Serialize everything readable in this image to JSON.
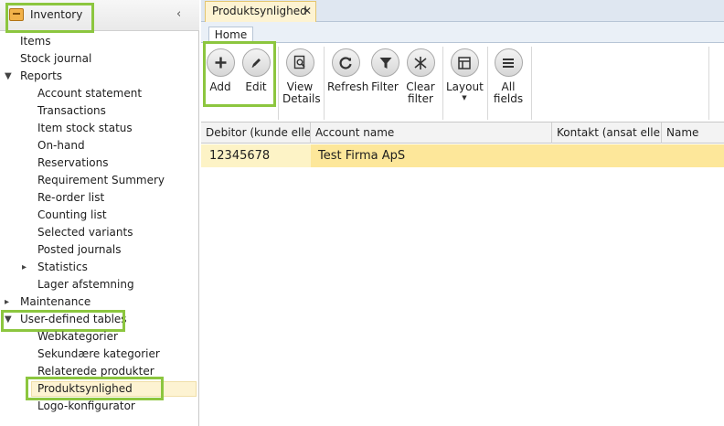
{
  "sidebar": {
    "module_title": "Inventory",
    "collapse_glyph": "‹",
    "items": [
      {
        "label": "Items"
      },
      {
        "label": "Stock journal"
      },
      {
        "label": "Reports"
      },
      {
        "label": "Account statement"
      },
      {
        "label": "Transactions"
      },
      {
        "label": "Item stock status"
      },
      {
        "label": "On-hand"
      },
      {
        "label": "Reservations"
      },
      {
        "label": "Requirement Summery"
      },
      {
        "label": "Re-order list"
      },
      {
        "label": "Counting list"
      },
      {
        "label": "Selected variants"
      },
      {
        "label": "Posted journals"
      },
      {
        "label": "Statistics"
      },
      {
        "label": "Lager afstemning"
      },
      {
        "label": "Maintenance"
      },
      {
        "label": "User-defined tables"
      },
      {
        "label": "Webkategorier"
      },
      {
        "label": "Sekundære kategorier"
      },
      {
        "label": "Relaterede produkter"
      },
      {
        "label": "Produktsynlighed"
      },
      {
        "label": "Logo-konfigurator"
      }
    ],
    "selected": "Produktsynlighed"
  },
  "tabs": {
    "document_tab": "Produktsynlighed",
    "close_glyph": "✕",
    "ribbon_tab": "Home"
  },
  "ribbon": {
    "add": "Add",
    "edit": "Edit",
    "view_details_1": "View",
    "view_details_2": "Details",
    "refresh": "Refresh",
    "filter": "Filter",
    "clear_filter_1": "Clear",
    "clear_filter_2": "filter",
    "layout": "Layout",
    "all_fields_1": "All",
    "all_fields_2": "fields"
  },
  "grid": {
    "columns": [
      "Debitor (kunde elle...",
      "Account name",
      "Kontakt (ansat eller...",
      "Name"
    ],
    "rows": [
      [
        "12345678",
        "Test Firma ApS",
        "",
        ""
      ]
    ]
  },
  "colors": {
    "highlight_box": "#8cc63f",
    "selected_row": "#fde79a",
    "tab_active": "#fdf3d2"
  }
}
